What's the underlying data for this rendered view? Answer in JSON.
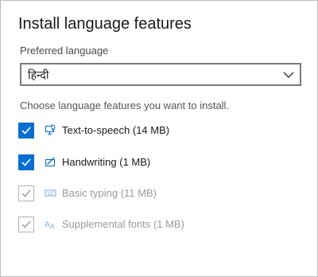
{
  "dialog": {
    "title": "Install language features",
    "preferred_label": "Preferred language",
    "preferred_value": "हिन्दी",
    "instruction": "Choose language features you want to install."
  },
  "features": [
    {
      "label": "Text-to-speech (14 MB)",
      "checked": true,
      "enabled": true,
      "icon": "computer-speech-icon"
    },
    {
      "label": "Handwriting (1 MB)",
      "checked": true,
      "enabled": true,
      "icon": "pen-icon"
    },
    {
      "label": "Basic typing (11 MB)",
      "checked": true,
      "enabled": false,
      "icon": "keyboard-icon"
    },
    {
      "label": "Supplemental fonts (1 MB)",
      "checked": true,
      "enabled": false,
      "icon": "font-icon"
    }
  ],
  "colors": {
    "accent": "#0a6ed1",
    "disabled": "#9a9a9a"
  }
}
